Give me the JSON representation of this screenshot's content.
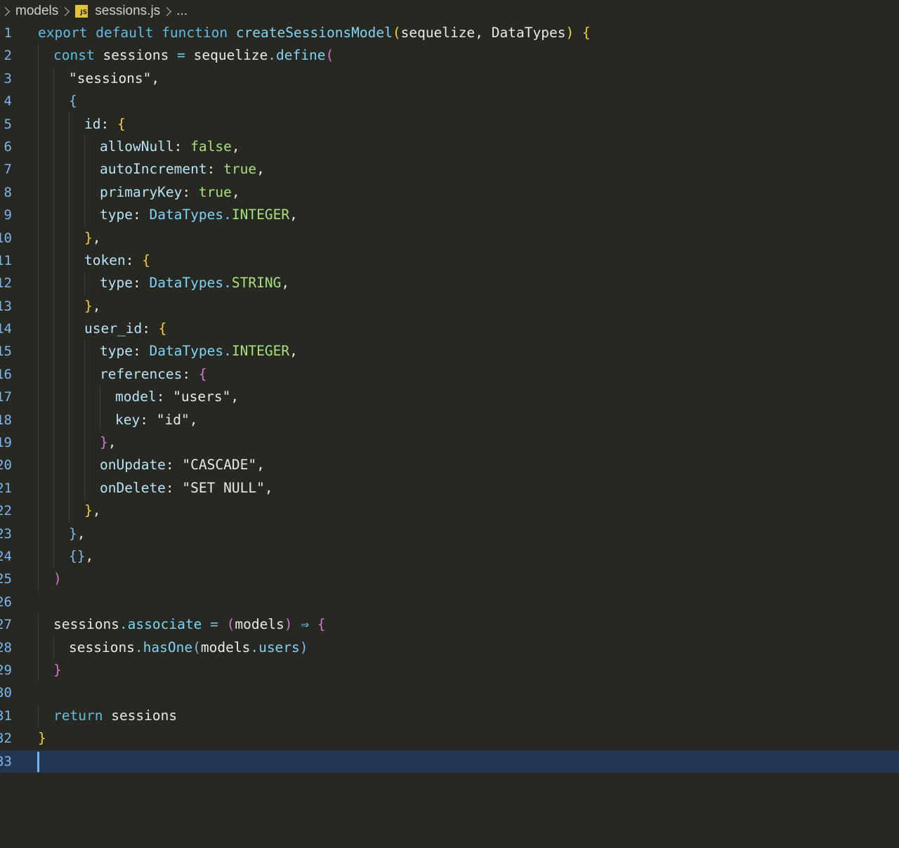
{
  "breadcrumb": {
    "folder": "models",
    "file": "sessions.js",
    "more": "...",
    "file_icon_text": "JS"
  },
  "editor": {
    "language": "javascript",
    "cursor_line": 33,
    "lines": [
      {
        "n": "1",
        "indent": 0,
        "tokens": [
          [
            "kw",
            "export"
          ],
          [
            "pn",
            " "
          ],
          [
            "kw",
            "default"
          ],
          [
            "pn",
            " "
          ],
          [
            "kw",
            "function"
          ],
          [
            "pn",
            " "
          ],
          [
            "fn",
            "createSessionsModel"
          ],
          [
            "b1",
            "("
          ],
          [
            "var",
            "sequelize"
          ],
          [
            "pn",
            ", "
          ],
          [
            "var",
            "DataTypes"
          ],
          [
            "b1",
            ")"
          ],
          [
            "pn",
            " "
          ],
          [
            "b1",
            "{"
          ]
        ]
      },
      {
        "n": "2",
        "indent": 1,
        "tokens": [
          [
            "kw",
            "const"
          ],
          [
            "pn",
            " "
          ],
          [
            "var",
            "sessions"
          ],
          [
            "pn",
            " "
          ],
          [
            "op",
            "="
          ],
          [
            "pn",
            " "
          ],
          [
            "var",
            "sequelize"
          ],
          [
            "op",
            "."
          ],
          [
            "fn",
            "define"
          ],
          [
            "b2",
            "("
          ]
        ]
      },
      {
        "n": "3",
        "indent": 2,
        "tokens": [
          [
            "str",
            "\"sessions\""
          ],
          [
            "pn",
            ","
          ]
        ]
      },
      {
        "n": "4",
        "indent": 2,
        "tokens": [
          [
            "b3",
            "{"
          ]
        ]
      },
      {
        "n": "5",
        "indent": 3,
        "tokens": [
          [
            "prop",
            "id"
          ],
          [
            "pn",
            ": "
          ],
          [
            "b1",
            "{"
          ]
        ]
      },
      {
        "n": "6",
        "indent": 4,
        "tokens": [
          [
            "prop",
            "allowNull"
          ],
          [
            "pn",
            ": "
          ],
          [
            "bool",
            "false"
          ],
          [
            "pn",
            ","
          ]
        ]
      },
      {
        "n": "7",
        "indent": 4,
        "tokens": [
          [
            "prop",
            "autoIncrement"
          ],
          [
            "pn",
            ": "
          ],
          [
            "bool",
            "true"
          ],
          [
            "pn",
            ","
          ]
        ]
      },
      {
        "n": "8",
        "indent": 4,
        "tokens": [
          [
            "prop",
            "primaryKey"
          ],
          [
            "pn",
            ": "
          ],
          [
            "bool",
            "true"
          ],
          [
            "pn",
            ","
          ]
        ]
      },
      {
        "n": "9",
        "indent": 4,
        "tokens": [
          [
            "prop",
            "type"
          ],
          [
            "pn",
            ": "
          ],
          [
            "fn",
            "DataTypes"
          ],
          [
            "op",
            "."
          ],
          [
            "bool",
            "INTEGER"
          ],
          [
            "pn",
            ","
          ]
        ]
      },
      {
        "n": "10",
        "indent": 3,
        "tokens": [
          [
            "b1",
            "}"
          ],
          [
            "pn",
            ","
          ]
        ]
      },
      {
        "n": "11",
        "indent": 3,
        "tokens": [
          [
            "prop",
            "token"
          ],
          [
            "pn",
            ": "
          ],
          [
            "b1",
            "{"
          ]
        ]
      },
      {
        "n": "12",
        "indent": 4,
        "tokens": [
          [
            "prop",
            "type"
          ],
          [
            "pn",
            ": "
          ],
          [
            "fn",
            "DataTypes"
          ],
          [
            "op",
            "."
          ],
          [
            "bool",
            "STRING"
          ],
          [
            "pn",
            ","
          ]
        ]
      },
      {
        "n": "13",
        "indent": 3,
        "tokens": [
          [
            "b1",
            "}"
          ],
          [
            "pn",
            ","
          ]
        ]
      },
      {
        "n": "14",
        "indent": 3,
        "tokens": [
          [
            "prop",
            "user_id"
          ],
          [
            "pn",
            ": "
          ],
          [
            "b1",
            "{"
          ]
        ]
      },
      {
        "n": "15",
        "indent": 4,
        "tokens": [
          [
            "prop",
            "type"
          ],
          [
            "pn",
            ": "
          ],
          [
            "fn",
            "DataTypes"
          ],
          [
            "op",
            "."
          ],
          [
            "bool",
            "INTEGER"
          ],
          [
            "pn",
            ","
          ]
        ]
      },
      {
        "n": "16",
        "indent": 4,
        "tokens": [
          [
            "prop",
            "references"
          ],
          [
            "pn",
            ": "
          ],
          [
            "b2",
            "{"
          ]
        ]
      },
      {
        "n": "17",
        "indent": 5,
        "tokens": [
          [
            "prop",
            "model"
          ],
          [
            "pn",
            ": "
          ],
          [
            "str",
            "\"users\""
          ],
          [
            "pn",
            ","
          ]
        ]
      },
      {
        "n": "18",
        "indent": 5,
        "tokens": [
          [
            "prop",
            "key"
          ],
          [
            "pn",
            ": "
          ],
          [
            "str",
            "\"id\""
          ],
          [
            "pn",
            ","
          ]
        ]
      },
      {
        "n": "19",
        "indent": 4,
        "tokens": [
          [
            "b2",
            "}"
          ],
          [
            "pn",
            ","
          ]
        ]
      },
      {
        "n": "20",
        "indent": 4,
        "tokens": [
          [
            "prop",
            "onUpdate"
          ],
          [
            "pn",
            ": "
          ],
          [
            "str",
            "\"CASCADE\""
          ],
          [
            "pn",
            ","
          ]
        ]
      },
      {
        "n": "21",
        "indent": 4,
        "tokens": [
          [
            "prop",
            "onDelete"
          ],
          [
            "pn",
            ": "
          ],
          [
            "str",
            "\"SET NULL\""
          ],
          [
            "pn",
            ","
          ]
        ]
      },
      {
        "n": "22",
        "indent": 3,
        "tokens": [
          [
            "b1",
            "}"
          ],
          [
            "pn",
            ","
          ]
        ]
      },
      {
        "n": "23",
        "indent": 2,
        "tokens": [
          [
            "b3",
            "}"
          ],
          [
            "pn",
            ","
          ]
        ]
      },
      {
        "n": "24",
        "indent": 2,
        "tokens": [
          [
            "b3",
            "{}"
          ],
          [
            "pn",
            ","
          ]
        ]
      },
      {
        "n": "25",
        "indent": 1,
        "tokens": [
          [
            "b2",
            ")"
          ]
        ]
      },
      {
        "n": "26",
        "indent": 0,
        "tokens": []
      },
      {
        "n": "27",
        "indent": 1,
        "tokens": [
          [
            "var",
            "sessions"
          ],
          [
            "op",
            "."
          ],
          [
            "fn",
            "associate"
          ],
          [
            "pn",
            " "
          ],
          [
            "op",
            "="
          ],
          [
            "pn",
            " "
          ],
          [
            "b2",
            "("
          ],
          [
            "var",
            "models"
          ],
          [
            "b2",
            ")"
          ],
          [
            "pn",
            " "
          ],
          [
            "op",
            "⇒"
          ],
          [
            "pn",
            " "
          ],
          [
            "b2",
            "{"
          ]
        ]
      },
      {
        "n": "28",
        "indent": 2,
        "tokens": [
          [
            "var",
            "sessions"
          ],
          [
            "op",
            "."
          ],
          [
            "fn",
            "hasOne"
          ],
          [
            "b3",
            "("
          ],
          [
            "var",
            "models"
          ],
          [
            "op",
            "."
          ],
          [
            "fn",
            "users"
          ],
          [
            "b3",
            ")"
          ]
        ]
      },
      {
        "n": "29",
        "indent": 1,
        "tokens": [
          [
            "b2",
            "}"
          ]
        ]
      },
      {
        "n": "30",
        "indent": 0,
        "tokens": []
      },
      {
        "n": "31",
        "indent": 1,
        "tokens": [
          [
            "kw",
            "return"
          ],
          [
            "pn",
            " "
          ],
          [
            "var",
            "sessions"
          ]
        ]
      },
      {
        "n": "32",
        "indent": 0,
        "tokens": [
          [
            "b1",
            "}"
          ]
        ]
      },
      {
        "n": "33",
        "indent": 0,
        "tokens": []
      }
    ]
  }
}
